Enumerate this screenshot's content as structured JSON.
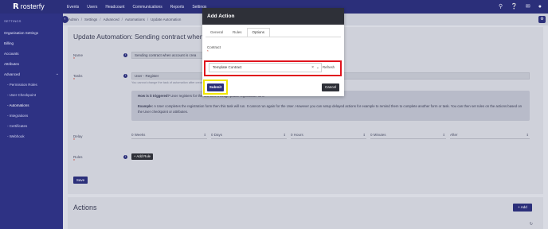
{
  "brand": {
    "mark": "R",
    "name": "rosterfy"
  },
  "nav": [
    "Events",
    "Users",
    "Headcount",
    "Communications",
    "Reports",
    "Settings"
  ],
  "top_icons": [
    "search-icon",
    "help-icon",
    "inbox-icon",
    "user-icon"
  ],
  "sidebar": {
    "heading": "SETTINGS",
    "items": [
      "Organisation Settings",
      "Billing",
      "Accounts",
      "Attributes",
      "Advanced"
    ],
    "sub_items": [
      "- Permission Roles",
      "- User Checkpoint",
      "- Automations",
      "- Integrations",
      "- Certificates",
      "- Webhook"
    ]
  },
  "breadcrumb": [
    "Admin",
    "Settings",
    "Advanced",
    "Automations",
    "Update Automation"
  ],
  "card": {
    "title": "Update Automation: Sending contract when acco",
    "name_label": "Name",
    "name_value": "Sending contract when account is crea",
    "tasks_label": "Tasks",
    "tasks_value": "User - Register",
    "tasks_hint": "You cannot change the task of automation after creation",
    "info_line1_bold": "How is it triggered?",
    "info_line1": " User registers for the first time through public registration form",
    "info_line2_bold": "Example:",
    "info_line2": " A User completes the registration form then this task will run. It cannot run again for the User. However you can setup delayed actions for example to remind them to complete another form or task. You can then set rules on the actions based on the User checkpoint or attributes.",
    "delay_label": "Delay",
    "delay_options": [
      "0 Weeks",
      "0 Days",
      "0 Hours",
      "0 Minutes",
      "After"
    ],
    "rules_label": "Rules",
    "add_rule": "+ Add Rule",
    "save": "Save"
  },
  "actions": {
    "title": "Actions",
    "add": "+ Add"
  },
  "modal": {
    "title": "Add Action",
    "tabs": [
      "General",
      "Rules",
      "Options"
    ],
    "active_tab": "Options",
    "contract_label": "Contract",
    "contract_value": "Template Contract",
    "refresh": "Refresh",
    "submit": "Submit",
    "cancel": "Cancel"
  },
  "colors": {
    "navbar": "#2b2f7a",
    "sidebar": "#2e3284",
    "highlight_red": "#e0141e",
    "highlight_yellow": "#f2e600"
  }
}
